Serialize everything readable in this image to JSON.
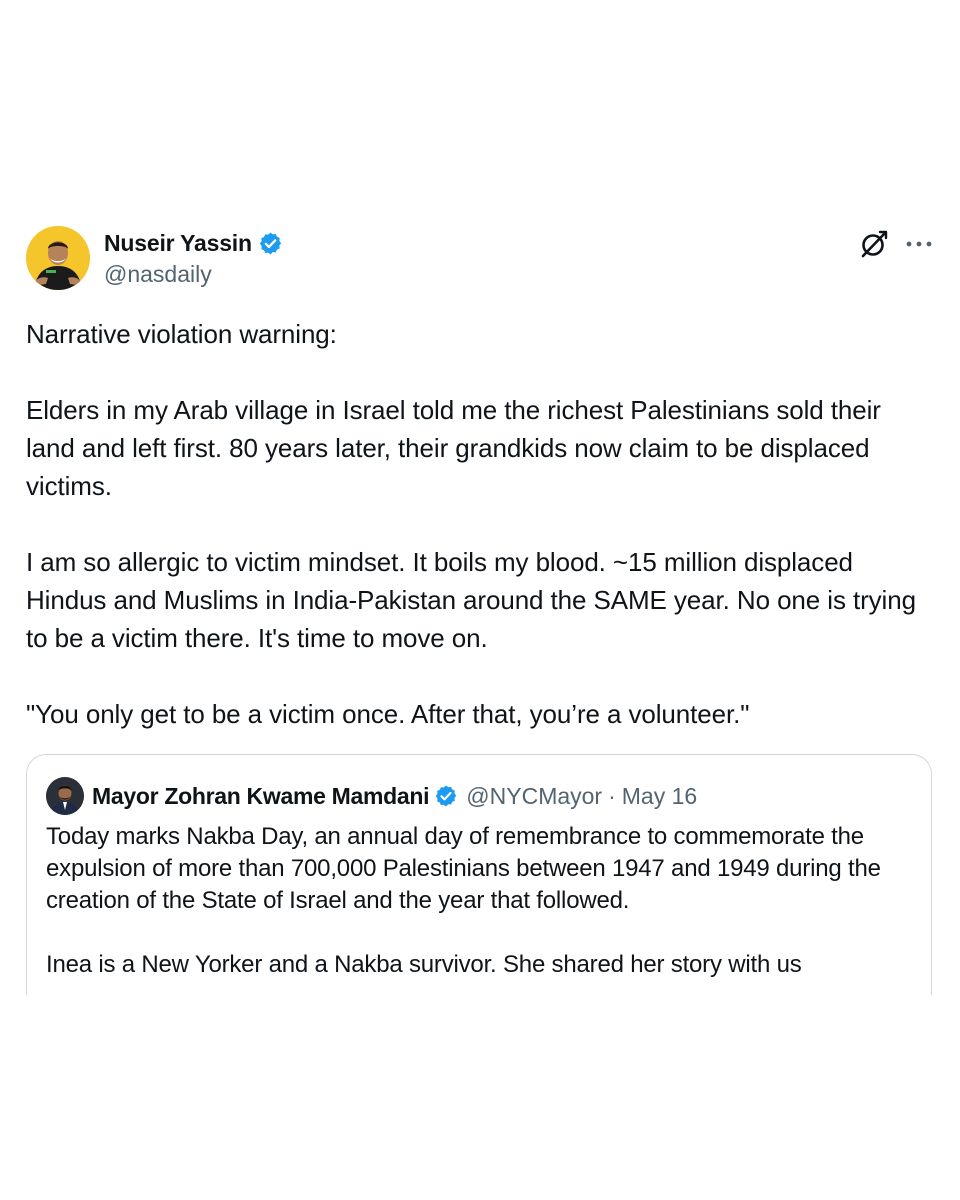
{
  "tweet": {
    "author_name": "Nuseir Yassin",
    "author_handle": "@nasdaily",
    "verified": true,
    "icons": {
      "verified": "verified-badge-icon",
      "grok": "grok-icon",
      "more": "more-options-icon"
    },
    "paragraphs": [
      "Narrative violation warning:",
      "Elders in my Arab village in Israel told me the richest Palestinians sold their land and left first. 80 years later, their grandkids now claim to be displaced victims.",
      "I am so allergic to victim mindset. It boils my blood. ~15 million displaced Hindus and Muslims in India-Pakistan around the SAME year. No one is trying to be a victim there. It's time to move on.",
      "\"You only get to be a victim once. After that, you’re a volunteer.\""
    ]
  },
  "quoted_tweet": {
    "author_name": "Mayor Zohran Kwame Mamdani",
    "author_handle": "@NYCMayor",
    "separator": "·",
    "date": "May 16",
    "verified": true,
    "paragraphs": [
      "Today marks Nakba Day, an annual day of remembrance to commemorate the expulsion of more than 700,000 Palestinians between 1947 and 1949 during the creation of the State of Israel and the year that followed.",
      "Inea is a New Yorker and a Nakba survivor. She shared her story with us"
    ]
  },
  "colors": {
    "text": "#0f1419",
    "secondary": "#536471",
    "verified": "#1d9bf0",
    "border": "#cfd9de",
    "avatar_bg": "#f4c62c"
  }
}
